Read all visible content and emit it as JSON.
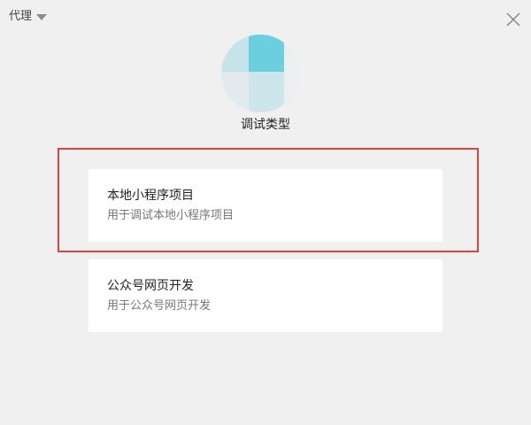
{
  "header": {
    "proxy_label": "代理",
    "proxy_icon": "chevron-down-icon",
    "close_icon": "close-icon"
  },
  "avatar": {
    "colors": [
      "#c6e2eb",
      "#6bcfdf",
      "#e7ecef",
      "#d4dde2"
    ]
  },
  "debug_type": {
    "title": "调试类型"
  },
  "options": [
    {
      "title": "本地小程序项目",
      "description": "用于调试本地小程序项目",
      "highlighted": true
    },
    {
      "title": "公众号网页开发",
      "description": "用于公众号网页开发",
      "highlighted": false
    }
  ],
  "colors": {
    "background": "#f0f0f0",
    "card_background": "#ffffff",
    "highlight_border": "#e0433a"
  }
}
